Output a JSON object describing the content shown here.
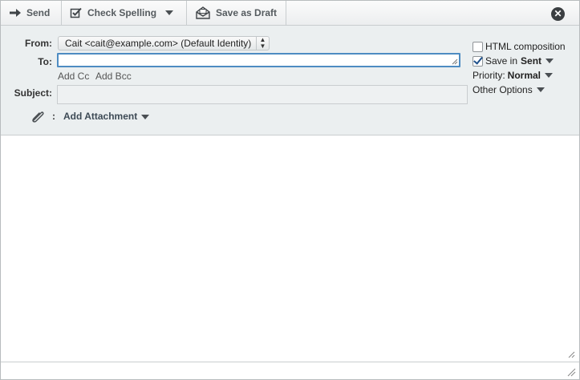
{
  "toolbar": {
    "send_label": "Send",
    "spell_label": "Check Spelling",
    "draft_label": "Save as Draft"
  },
  "header": {
    "from_label": "From:",
    "from_value": "Cait <cait@example.com> (Default Identity)",
    "to_label": "To:",
    "to_value": "",
    "add_cc": "Add Cc",
    "add_bcc": "Add Bcc",
    "subject_label": "Subject:",
    "subject_value": "",
    "attach_colon": ":",
    "add_attachment": "Add Attachment"
  },
  "options": {
    "html_composition": "HTML composition",
    "html_composition_checked": false,
    "save_in": "Save in",
    "save_folder": "Sent",
    "save_checked": true,
    "priority_label": "Priority:",
    "priority_value": "Normal",
    "other_options": "Other Options"
  },
  "colors": {
    "accent_focus": "#4e8cc2",
    "header_bg": "#ebeff0",
    "close_bg": "#3b3f42"
  },
  "icons": {
    "send": "arrow-right-icon",
    "spell": "checkbox-check-icon",
    "draft": "envelope-open-icon",
    "close": "close-circle-icon",
    "attach": "paperclip-icon"
  }
}
